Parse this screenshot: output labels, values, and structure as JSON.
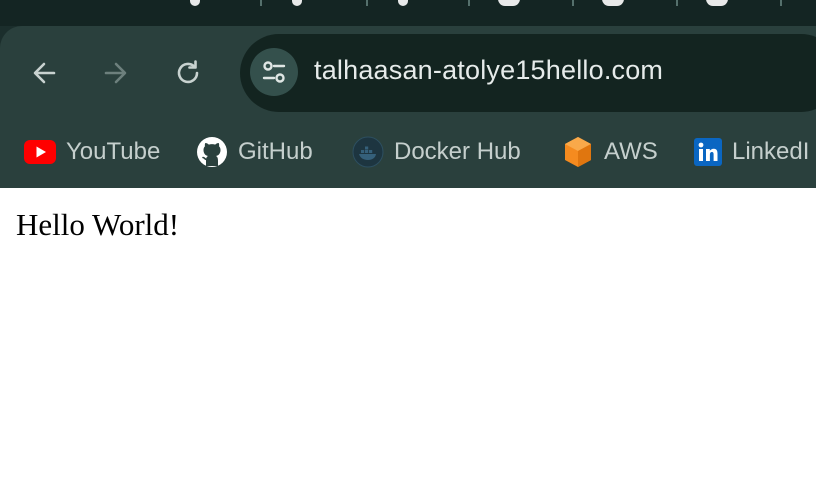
{
  "address_bar": {
    "url": "talhaasan-atolye15hello.com"
  },
  "bookmarks": [
    {
      "label": "YouTube",
      "icon": "youtube-icon"
    },
    {
      "label": "GitHub",
      "icon": "github-icon"
    },
    {
      "label": "Docker Hub",
      "icon": "docker-icon"
    },
    {
      "label": "AWS",
      "icon": "aws-icon"
    },
    {
      "label": "LinkedI",
      "icon": "linkedin-icon"
    }
  ],
  "page": {
    "heading": "Hello World!"
  },
  "colors": {
    "frame": "#1b2e2c",
    "toolbar": "#2a403d",
    "omnibox": "#132420",
    "bookmark_text": "#c5cfcd",
    "youtube_red": "#ff0000",
    "aws_orange": "#f58b1f",
    "linkedin_blue": "#0a66c2"
  }
}
